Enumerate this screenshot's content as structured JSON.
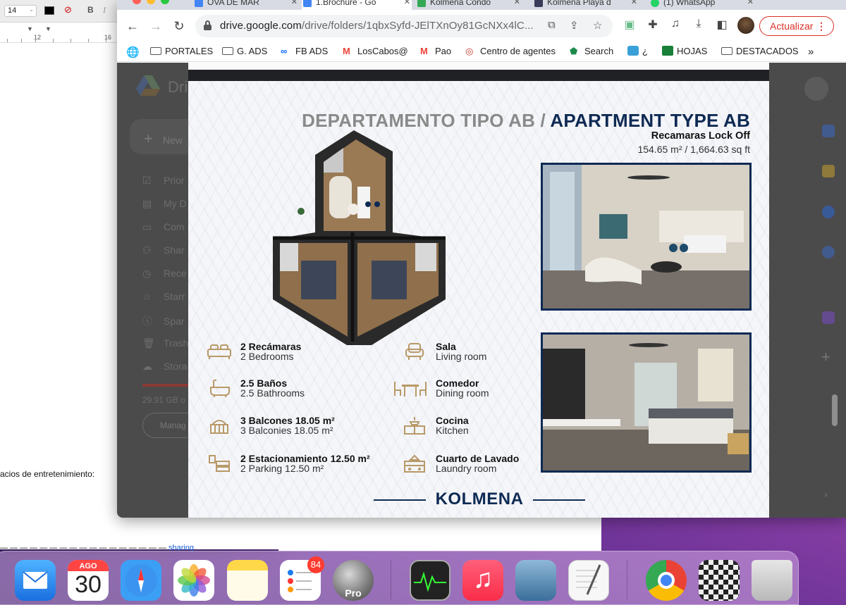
{
  "doc": {
    "font_size": "14",
    "bold": "B",
    "italic": "I",
    "ruler_12": "12",
    "ruler_16": "16",
    "text_line1": "acios de entretenimiento:",
    "text_line2_prefix": "",
    "text_line2_link": "sharing"
  },
  "browser": {
    "tabs": [
      {
        "label": "OVA DE MAR"
      },
      {
        "label": "1.Brochure - Go"
      },
      {
        "label": "Kolmena Condo"
      },
      {
        "label": "Kolmena Playa d"
      },
      {
        "label": "(1) WhatsApp"
      }
    ],
    "url_host": "drive.google.com",
    "url_path": "/drive/folders/1qbxSyfd-JElTXnOy81GcNXx4lC...",
    "update_label": "Actualizar",
    "bookmarks": [
      {
        "label": "PORTALES",
        "icon": "folder-icon"
      },
      {
        "label": "G. ADS",
        "icon": "folder-icon"
      },
      {
        "label": "FB ADS",
        "icon": "meta-icon"
      },
      {
        "label": "LosCabos@",
        "icon": "gmail-icon"
      },
      {
        "label": "Pao",
        "icon": "gmail-icon"
      },
      {
        "label": "Centro de agentes",
        "icon": "swirl-icon"
      },
      {
        "label": "Search",
        "icon": "search-app-icon"
      },
      {
        "label": "¿",
        "icon": "app-icon"
      },
      {
        "label": "HOJAS",
        "icon": "sheets-icon"
      },
      {
        "label": "DESTACADOS",
        "icon": "folder-icon"
      }
    ],
    "more_bookmarks": "»"
  },
  "drive": {
    "logo_text": "Dri",
    "new_label": "New",
    "sidebar": [
      {
        "label": "Prior",
        "icon": "check-icon"
      },
      {
        "label": "My D",
        "icon": "drive-icon"
      },
      {
        "label": "Com",
        "icon": "computers-icon"
      },
      {
        "label": "Shar",
        "icon": "shared-icon"
      },
      {
        "label": "Rece",
        "icon": "clock-icon"
      },
      {
        "label": "Starr",
        "icon": "star-icon"
      },
      {
        "label": "Spar",
        "icon": "spam-icon"
      },
      {
        "label": "Trash",
        "icon": "trash-icon"
      },
      {
        "label": "Stora",
        "icon": "cloud-icon"
      }
    ],
    "storage_text": "29.91 GB o",
    "manage_label": "Manag"
  },
  "brochure": {
    "title_es": "DEPARTAMENTO TIPO AB /",
    "title_en": "APARTMENT TYPE AB",
    "subtitle": "Recamaras Lock Off",
    "area": "154.65 m² / 1,664.63 sq ft",
    "features_left": [
      {
        "title": "2 Recámaras",
        "sub": "2 Bedrooms",
        "icon": "bed-icon"
      },
      {
        "title": "2.5 Baños",
        "sub": "2.5 Bathrooms",
        "icon": "bathtub-icon"
      },
      {
        "title": "3 Balcones 18.05 m²",
        "sub": "3 Balconies 18.05 m²",
        "icon": "balcony-icon"
      },
      {
        "title": "2 Estacionamiento 12.50 m²",
        "sub": "2 Parking 12.50 m²",
        "icon": "parking-icon"
      }
    ],
    "features_right": [
      {
        "title": "Sala",
        "sub": "Living room",
        "icon": "armchair-icon"
      },
      {
        "title": "Comedor",
        "sub": "Dining room",
        "icon": "dining-icon"
      },
      {
        "title": "Cocina",
        "sub": "Kitchen",
        "icon": "kitchen-icon"
      },
      {
        "title": "Cuarto de Lavado",
        "sub": "Laundry room",
        "icon": "laundry-icon"
      }
    ],
    "brand": "KOLMENA"
  },
  "dock": {
    "calendar_month": "AGO",
    "calendar_day": "30",
    "reminders_badge": "84",
    "pro_label": "Pro",
    "apps": [
      "mail-icon",
      "calendar-icon",
      "safari-icon",
      "photos-icon",
      "notes-icon",
      "reminders-icon",
      "earth-pro-icon",
      "activity-monitor-icon",
      "music-icon",
      "preview-icon",
      "textedit-icon",
      "chrome-icon",
      "chess-icon",
      "trash-icon"
    ]
  },
  "colors": {
    "brand_navy": "#0e2a54",
    "title_gray": "#8a8a8a",
    "gold_icon": "#b89968",
    "update_red": "#d93025"
  }
}
